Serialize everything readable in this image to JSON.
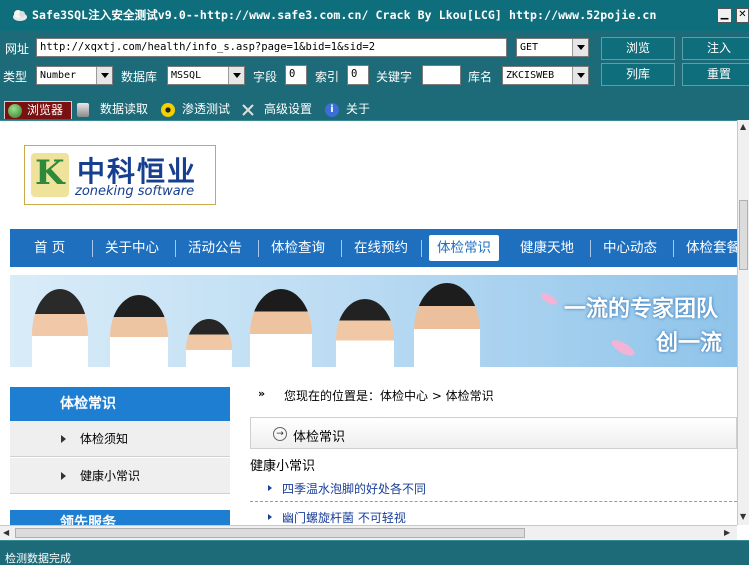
{
  "window": {
    "title": "Safe3SQL注入安全测试v9.0--http://www.safe3.com.cn/   Crack By Lkou[LCG]  http://www.52pojie.cn",
    "minimize_glyph": "▁",
    "close_glyph": "✕"
  },
  "toolbar": {
    "url_label": "网址",
    "url_value": "http://xqxtj.com/health/info_s.asp?page=1&bid=1&sid=2",
    "method_value": "GET",
    "browse_button": "浏览",
    "inject_button": "注入",
    "type_label": "类型",
    "type_value": "Number",
    "db_label": "数据库",
    "db_value": "MSSQL",
    "field_label": "字段",
    "field_value": "0",
    "index_label": "索引",
    "index_value": "0",
    "keyword_label": "关键字",
    "keyword_value": "",
    "dbname_label": "库名",
    "dbname_value": "ZKCISWEB",
    "list_db_button": "列库",
    "reset_button": "重置"
  },
  "tabs": [
    {
      "label": "浏览器",
      "icon": "globe-icon",
      "active": true
    },
    {
      "label": "数据读取",
      "icon": "database-icon",
      "active": false
    },
    {
      "label": "渗透测试",
      "icon": "radiation-icon",
      "active": false
    },
    {
      "label": "高级设置",
      "icon": "tools-icon",
      "active": false
    },
    {
      "label": "关于",
      "icon": "info-icon",
      "active": false
    }
  ],
  "page": {
    "logo_cn": "中科恒业",
    "logo_en": "zoneking software",
    "nav": [
      "首 页",
      "关于中心",
      "活动公告",
      "体检查询",
      "在线预约",
      "体检常识",
      "健康天地",
      "中心动态",
      "体检套餐"
    ],
    "nav_active": "体检常识",
    "banner_line1": "一流的专家团队",
    "banner_line2": "创一流",
    "side_title": "体检常识",
    "side_items": [
      "体检须知",
      "健康小常识"
    ],
    "side_title2": "领先服务",
    "breadcrumb_arrows": "»",
    "breadcrumb": "您现在的位置是：体检中心 > 体检常识",
    "section_title": "体检常识",
    "section_icon": "→",
    "sub_heading": "健康小常识",
    "news": [
      "四季温水泡脚的好处各不同",
      "幽门螺旋杆菌  不可轻视"
    ]
  },
  "statusbar": {
    "text": "检测数据完成"
  },
  "colors": {
    "app_teal": "#1d6a78",
    "nav_blue": "#1f6fbf",
    "active_tab": "#7b1010",
    "link_blue": "#1a3f99"
  }
}
